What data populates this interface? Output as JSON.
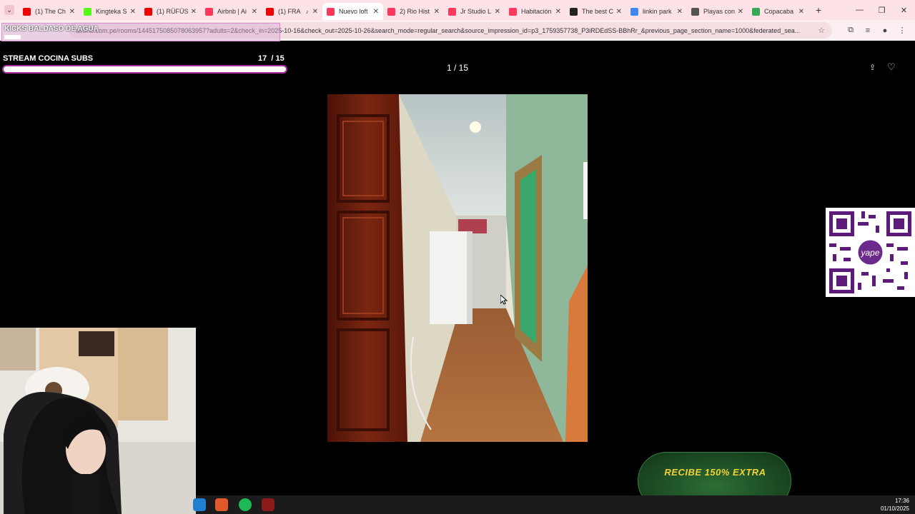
{
  "browser": {
    "tabs": [
      {
        "title": "(1) The Ch",
        "favicon": "youtube-icon",
        "color": "#e00",
        "active": false
      },
      {
        "title": "Kingteka S",
        "favicon": "kick-icon",
        "color": "#53fc18",
        "active": false
      },
      {
        "title": "(1) RÜFÜS",
        "favicon": "youtube-icon",
        "color": "#e00",
        "active": false
      },
      {
        "title": "Airbnb | Ai",
        "favicon": "airbnb-icon",
        "color": "#ff385c",
        "active": false
      },
      {
        "title": "(1) FRA",
        "favicon": "youtube-icon",
        "color": "#e00",
        "active": false,
        "audio": true
      },
      {
        "title": "Nuevo loft",
        "favicon": "airbnb-icon",
        "color": "#ff385c",
        "active": true
      },
      {
        "title": "2) Rio Hist",
        "favicon": "airbnb-icon",
        "color": "#ff385c",
        "active": false
      },
      {
        "title": "Jr Studio L",
        "favicon": "airbnb-icon",
        "color": "#ff385c",
        "active": false
      },
      {
        "title": "Habitación",
        "favicon": "airbnb-icon",
        "color": "#ff385c",
        "active": false
      },
      {
        "title": "The best C",
        "favicon": "site-icon",
        "color": "#222",
        "active": false
      },
      {
        "title": "linkin park",
        "favicon": "google-icon",
        "color": "#4285f4",
        "active": false
      },
      {
        "title": "Playas con",
        "favicon": "globe-icon",
        "color": "#555",
        "active": false
      },
      {
        "title": "Copacaba",
        "favicon": "maps-icon",
        "color": "#34a853",
        "active": false
      }
    ],
    "url": "airbnb.com.pe/rooms/1445175085078063957?adults=2&check_in=2025-10-16&check_out=2025-10-26&search_mode=regular_search&source_impression_id=p3_1759357738_P3iRDEdSS-BBhRr_&previous_page_section_name=1000&federated_sea..."
  },
  "overlay": {
    "kicks_title": "KICKS BALDASO DE AGUA",
    "kicks_progress": 0.06,
    "subs_title": "STREAM COCINA SUBS",
    "subs_count": "17",
    "subs_total": "/ 15",
    "subs_progress": 1.0
  },
  "viewer": {
    "counter": "1 / 15"
  },
  "promo": {
    "text": "RECIBE 150% EXTRA"
  },
  "taskbar": {
    "time": "17:36",
    "date": "01/10/2025",
    "apps": [
      {
        "name": "edge-icon",
        "color": "#1f7fd1"
      },
      {
        "name": "brave-icon",
        "color": "#e3582a"
      },
      {
        "name": "spotify-icon",
        "color": "#1db954"
      },
      {
        "name": "app-icon",
        "color": "#8b1a1a"
      }
    ]
  },
  "colors": {
    "tabstrip": "#fde3e8",
    "accent": "#ff385c",
    "progress_border": "#a82ea6",
    "promo_text": "#f4d23a"
  }
}
